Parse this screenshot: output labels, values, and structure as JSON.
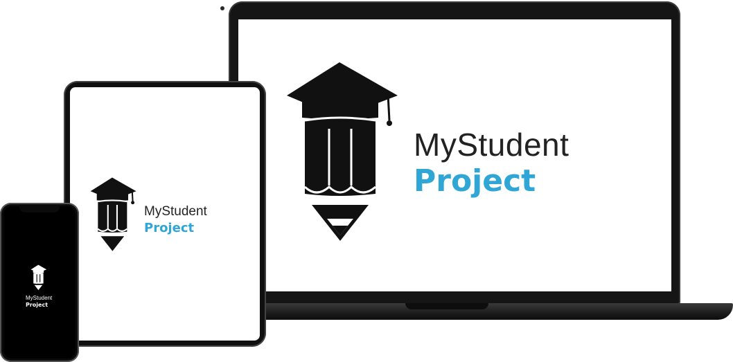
{
  "brand": {
    "name_line1": "MyStudent",
    "name_line2": "Project",
    "text_color_light": "#222222",
    "text_color_dark": "#ffffff",
    "accent_color": "#2fa6d6",
    "icon_name": "graduation-cap-pencil-icon"
  },
  "devices": [
    "laptop",
    "tablet",
    "phone"
  ]
}
